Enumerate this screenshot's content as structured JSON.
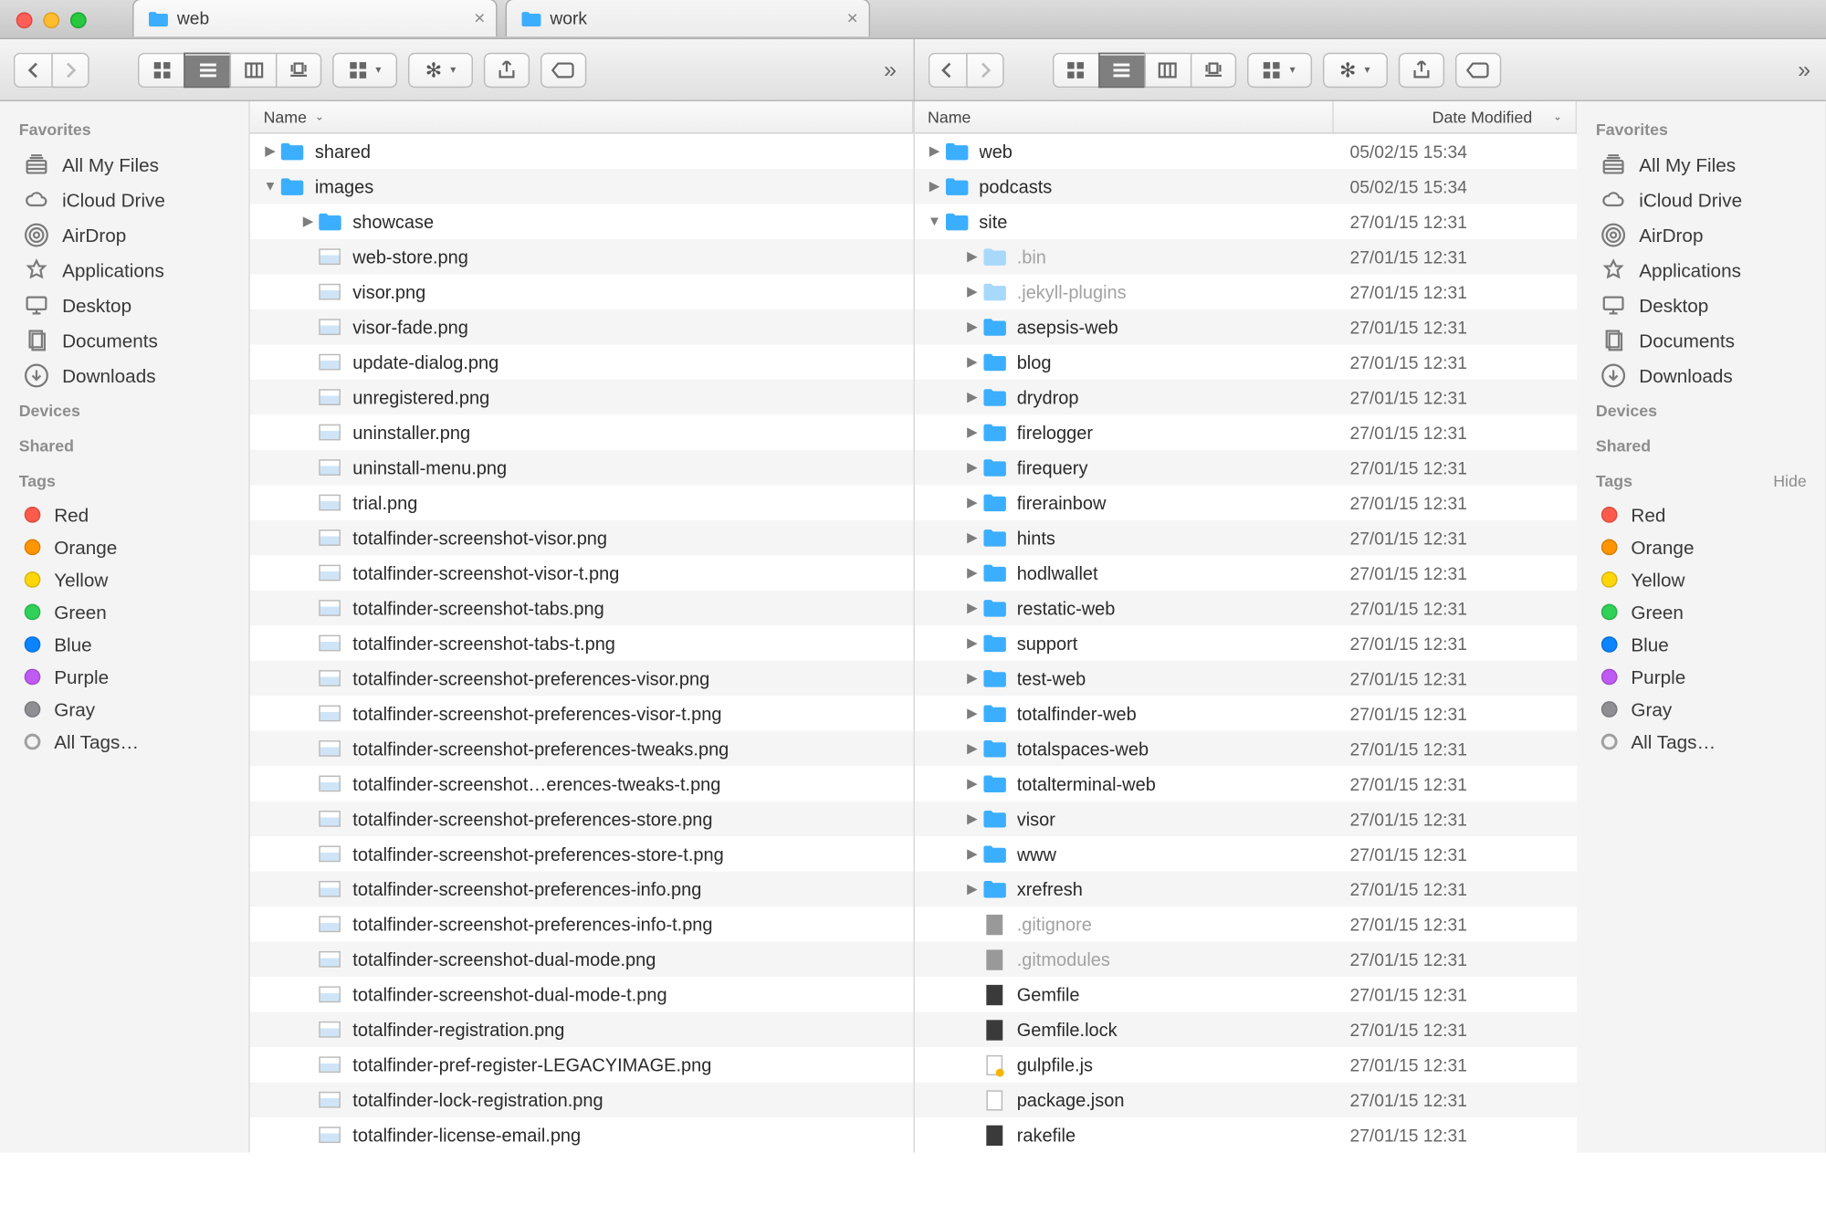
{
  "tabs": [
    {
      "label": "web",
      "active": true
    },
    {
      "label": "work",
      "active": false
    }
  ],
  "sidebar": {
    "favorites": "Favorites",
    "devices": "Devices",
    "shared": "Shared",
    "tags": "Tags",
    "hide": "Hide",
    "items": [
      {
        "label": "All My Files",
        "icon": "all-files-icon"
      },
      {
        "label": "iCloud Drive",
        "icon": "cloud-icon"
      },
      {
        "label": "AirDrop",
        "icon": "airdrop-icon"
      },
      {
        "label": "Applications",
        "icon": "applications-icon"
      },
      {
        "label": "Desktop",
        "icon": "desktop-icon"
      },
      {
        "label": "Documents",
        "icon": "documents-icon"
      },
      {
        "label": "Downloads",
        "icon": "downloads-icon"
      }
    ],
    "tag_items": [
      {
        "label": "Red",
        "color": "#ff5b4c"
      },
      {
        "label": "Orange",
        "color": "#ff9500"
      },
      {
        "label": "Yellow",
        "color": "#ffd60a"
      },
      {
        "label": "Green",
        "color": "#30d158"
      },
      {
        "label": "Blue",
        "color": "#0a84ff"
      },
      {
        "label": "Purple",
        "color": "#bf5af2"
      },
      {
        "label": "Gray",
        "color": "#8e8e93"
      }
    ],
    "all_tags": "All Tags…"
  },
  "columns": {
    "name": "Name",
    "date": "Date Modified"
  },
  "left_rows": [
    {
      "d": 0,
      "a": "r",
      "t": "folder",
      "n": "shared"
    },
    {
      "d": 0,
      "a": "d",
      "t": "folder",
      "n": "images"
    },
    {
      "d": 1,
      "a": "r",
      "t": "folder",
      "n": "showcase"
    },
    {
      "d": 1,
      "a": "",
      "t": "img",
      "n": "web-store.png"
    },
    {
      "d": 1,
      "a": "",
      "t": "img",
      "n": "visor.png"
    },
    {
      "d": 1,
      "a": "",
      "t": "img",
      "n": "visor-fade.png"
    },
    {
      "d": 1,
      "a": "",
      "t": "img",
      "n": "update-dialog.png"
    },
    {
      "d": 1,
      "a": "",
      "t": "img",
      "n": "unregistered.png"
    },
    {
      "d": 1,
      "a": "",
      "t": "img",
      "n": "uninstaller.png"
    },
    {
      "d": 1,
      "a": "",
      "t": "img",
      "n": "uninstall-menu.png"
    },
    {
      "d": 1,
      "a": "",
      "t": "img",
      "n": "trial.png"
    },
    {
      "d": 1,
      "a": "",
      "t": "img",
      "n": "totalfinder-screenshot-visor.png"
    },
    {
      "d": 1,
      "a": "",
      "t": "img",
      "n": "totalfinder-screenshot-visor-t.png"
    },
    {
      "d": 1,
      "a": "",
      "t": "img",
      "n": "totalfinder-screenshot-tabs.png"
    },
    {
      "d": 1,
      "a": "",
      "t": "img",
      "n": "totalfinder-screenshot-tabs-t.png"
    },
    {
      "d": 1,
      "a": "",
      "t": "img",
      "n": "totalfinder-screenshot-preferences-visor.png"
    },
    {
      "d": 1,
      "a": "",
      "t": "img",
      "n": "totalfinder-screenshot-preferences-visor-t.png"
    },
    {
      "d": 1,
      "a": "",
      "t": "img",
      "n": "totalfinder-screenshot-preferences-tweaks.png"
    },
    {
      "d": 1,
      "a": "",
      "t": "img",
      "n": "totalfinder-screenshot…erences-tweaks-t.png"
    },
    {
      "d": 1,
      "a": "",
      "t": "img",
      "n": "totalfinder-screenshot-preferences-store.png"
    },
    {
      "d": 1,
      "a": "",
      "t": "img",
      "n": "totalfinder-screenshot-preferences-store-t.png"
    },
    {
      "d": 1,
      "a": "",
      "t": "img",
      "n": "totalfinder-screenshot-preferences-info.png"
    },
    {
      "d": 1,
      "a": "",
      "t": "img",
      "n": "totalfinder-screenshot-preferences-info-t.png"
    },
    {
      "d": 1,
      "a": "",
      "t": "img",
      "n": "totalfinder-screenshot-dual-mode.png"
    },
    {
      "d": 1,
      "a": "",
      "t": "img",
      "n": "totalfinder-screenshot-dual-mode-t.png"
    },
    {
      "d": 1,
      "a": "",
      "t": "img",
      "n": "totalfinder-registration.png"
    },
    {
      "d": 1,
      "a": "",
      "t": "img",
      "n": "totalfinder-pref-register-LEGACYIMAGE.png"
    },
    {
      "d": 1,
      "a": "",
      "t": "img",
      "n": "totalfinder-lock-registration.png"
    },
    {
      "d": 1,
      "a": "",
      "t": "img",
      "n": "totalfinder-license-email.png"
    }
  ],
  "right_rows": [
    {
      "d": 0,
      "a": "r",
      "t": "folder",
      "n": "web",
      "dt": "05/02/15 15:34"
    },
    {
      "d": 0,
      "a": "r",
      "t": "folder",
      "n": "podcasts",
      "dt": "05/02/15 15:34"
    },
    {
      "d": 0,
      "a": "d",
      "t": "folder",
      "n": "site",
      "dt": "27/01/15 12:31"
    },
    {
      "d": 1,
      "a": "r",
      "t": "folder-dim",
      "n": ".bin",
      "dt": "27/01/15 12:31",
      "dim": true
    },
    {
      "d": 1,
      "a": "r",
      "t": "folder-dim",
      "n": ".jekyll-plugins",
      "dt": "27/01/15 12:31",
      "dim": true
    },
    {
      "d": 1,
      "a": "r",
      "t": "folder",
      "n": "asepsis-web",
      "dt": "27/01/15 12:31"
    },
    {
      "d": 1,
      "a": "r",
      "t": "folder",
      "n": "blog",
      "dt": "27/01/15 12:31"
    },
    {
      "d": 1,
      "a": "r",
      "t": "folder",
      "n": "drydrop",
      "dt": "27/01/15 12:31"
    },
    {
      "d": 1,
      "a": "r",
      "t": "folder",
      "n": "firelogger",
      "dt": "27/01/15 12:31"
    },
    {
      "d": 1,
      "a": "r",
      "t": "folder",
      "n": "firequery",
      "dt": "27/01/15 12:31"
    },
    {
      "d": 1,
      "a": "r",
      "t": "folder",
      "n": "firerainbow",
      "dt": "27/01/15 12:31"
    },
    {
      "d": 1,
      "a": "r",
      "t": "folder",
      "n": "hints",
      "dt": "27/01/15 12:31"
    },
    {
      "d": 1,
      "a": "r",
      "t": "folder",
      "n": "hodlwallet",
      "dt": "27/01/15 12:31"
    },
    {
      "d": 1,
      "a": "r",
      "t": "folder",
      "n": "restatic-web",
      "dt": "27/01/15 12:31"
    },
    {
      "d": 1,
      "a": "r",
      "t": "folder",
      "n": "support",
      "dt": "27/01/15 12:31"
    },
    {
      "d": 1,
      "a": "r",
      "t": "folder",
      "n": "test-web",
      "dt": "27/01/15 12:31"
    },
    {
      "d": 1,
      "a": "r",
      "t": "folder",
      "n": "totalfinder-web",
      "dt": "27/01/15 12:31"
    },
    {
      "d": 1,
      "a": "r",
      "t": "folder",
      "n": "totalspaces-web",
      "dt": "27/01/15 12:31"
    },
    {
      "d": 1,
      "a": "r",
      "t": "folder",
      "n": "totalterminal-web",
      "dt": "27/01/15 12:31"
    },
    {
      "d": 1,
      "a": "r",
      "t": "folder",
      "n": "visor",
      "dt": "27/01/15 12:31"
    },
    {
      "d": 1,
      "a": "r",
      "t": "folder",
      "n": "www",
      "dt": "27/01/15 12:31"
    },
    {
      "d": 1,
      "a": "r",
      "t": "folder",
      "n": "xrefresh",
      "dt": "27/01/15 12:31"
    },
    {
      "d": 1,
      "a": "",
      "t": "doc-gray",
      "n": ".gitignore",
      "dt": "27/01/15 12:31",
      "dim": true
    },
    {
      "d": 1,
      "a": "",
      "t": "doc-gray",
      "n": ".gitmodules",
      "dt": "27/01/15 12:31",
      "dim": true
    },
    {
      "d": 1,
      "a": "",
      "t": "doc-dark",
      "n": "Gemfile",
      "dt": "27/01/15 12:31"
    },
    {
      "d": 1,
      "a": "",
      "t": "doc-dark",
      "n": "Gemfile.lock",
      "dt": "27/01/15 12:31"
    },
    {
      "d": 1,
      "a": "",
      "t": "doc-js",
      "n": "gulpfile.js",
      "dt": "27/01/15 12:31"
    },
    {
      "d": 1,
      "a": "",
      "t": "doc",
      "n": "package.json",
      "dt": "27/01/15 12:31"
    },
    {
      "d": 1,
      "a": "",
      "t": "doc-dark",
      "n": "rakefile",
      "dt": "27/01/15 12:31"
    }
  ]
}
